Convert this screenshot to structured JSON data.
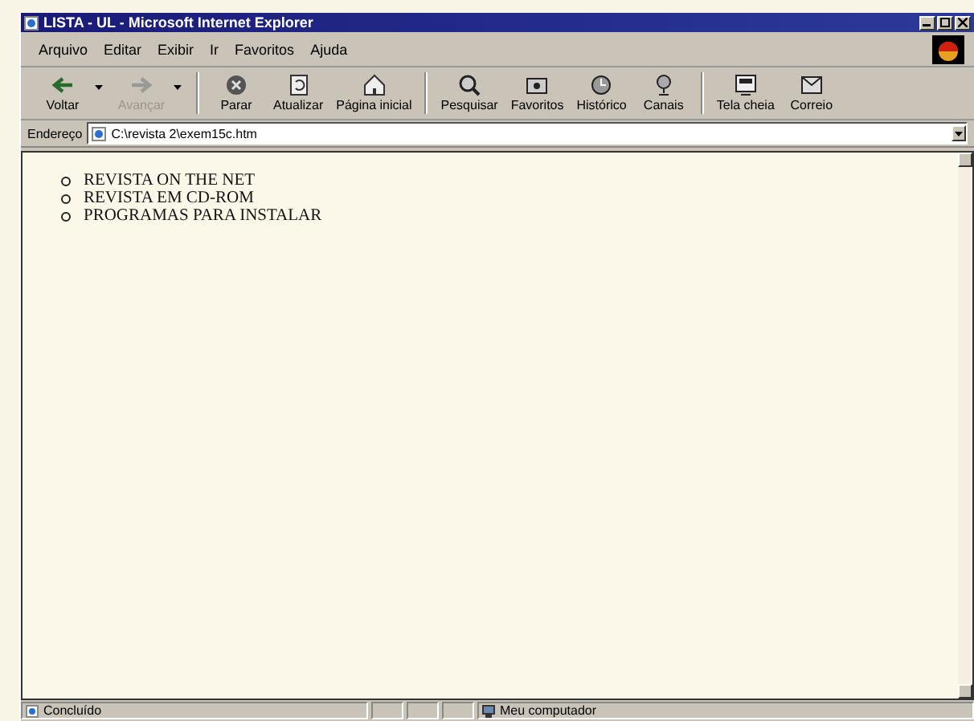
{
  "window": {
    "title": "LISTA - UL - Microsoft Internet Explorer"
  },
  "menu": [
    "Arquivo",
    "Editar",
    "Exibir",
    "Ir",
    "Favoritos",
    "Ajuda"
  ],
  "toolbar": [
    {
      "label": "Voltar",
      "kind": "back",
      "disabled": false,
      "dropdown": true
    },
    {
      "label": "Avançar",
      "kind": "forward",
      "disabled": true,
      "dropdown": true
    },
    {
      "label": "Parar",
      "kind": "stop",
      "disabled": false,
      "dropdown": false
    },
    {
      "label": "Atualizar",
      "kind": "refresh",
      "disabled": false,
      "dropdown": false
    },
    {
      "label": "Página inicial",
      "kind": "home",
      "disabled": false,
      "dropdown": false
    },
    {
      "label": "Pesquisar",
      "kind": "search",
      "disabled": false,
      "dropdown": false
    },
    {
      "label": "Favoritos",
      "kind": "favorites",
      "disabled": false,
      "dropdown": false
    },
    {
      "label": "Histórico",
      "kind": "history",
      "disabled": false,
      "dropdown": false
    },
    {
      "label": "Canais",
      "kind": "channels",
      "disabled": false,
      "dropdown": false
    },
    {
      "label": "Tela cheia",
      "kind": "fullscreen",
      "disabled": false,
      "dropdown": false
    },
    {
      "label": "Correio",
      "kind": "mail",
      "disabled": false,
      "dropdown": false
    }
  ],
  "address": {
    "label": "Endereço",
    "value": "C:\\revista 2\\exem15c.htm"
  },
  "content": {
    "list": [
      "REVISTA ON THE NET",
      "REVISTA EM CD-ROM",
      "PROGRAMAS PARA INSTALAR"
    ]
  },
  "status_bar": {
    "text": "Concluído",
    "zone": "Meu computador"
  }
}
